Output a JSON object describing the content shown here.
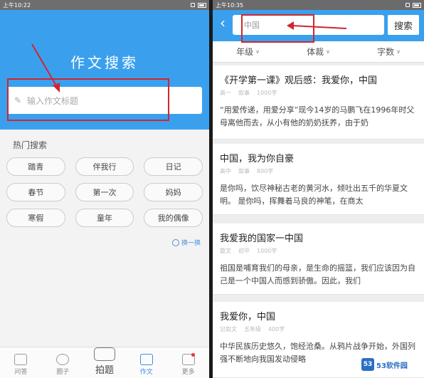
{
  "left": {
    "status_time": "上午10:22",
    "page_title": "作文搜索",
    "search_placeholder": "输入作文标题",
    "hot_title": "热门搜索",
    "tags": [
      "踏青",
      "伴我行",
      "日记",
      "春节",
      "第一次",
      "妈妈",
      "寒假",
      "童年",
      "我的偶像"
    ],
    "refresh_label": "换一换",
    "tabs": [
      {
        "label": "问答",
        "icon": "chat-icon"
      },
      {
        "label": "圈子",
        "icon": "circle-icon"
      },
      {
        "label": "拍题",
        "icon": "camera-icon"
      },
      {
        "label": "作文",
        "icon": "document-icon"
      },
      {
        "label": "更多",
        "icon": "more-icon"
      }
    ]
  },
  "right": {
    "status_time": "上午10:35",
    "search_value": "中国",
    "search_button": "搜索",
    "filters": [
      "年级",
      "体裁",
      "字数"
    ],
    "results": [
      {
        "title": "《开学第一课》观后感：我爱你，中国",
        "meta": [
          "高一",
          "叙事",
          "1000字"
        ],
        "snippet": "“用爱传递，用爱分享”现今14岁的马鹏飞在1996年时父母离他而去，从小有他的奶奶抚养，由于奶"
      },
      {
        "title": "中国，我为你自豪",
        "meta": [
          "高中",
          "叙事",
          "800字"
        ],
        "snippet": "是你吗，饮尽神秘古老的黄河水，倾吐出五千的华夏文明。 是你吗，挥舞着马良的神笔，在商太"
      },
      {
        "title": "我爱我的国家一中国",
        "meta": [
          "散文",
          "初中",
          "1000字"
        ],
        "snippet": "祖国是哺育我们的母亲，是生命的摇篮，我们应该因为自己是一个中国人而感到骄傲。因此，我们"
      },
      {
        "title": "我爱你，中国",
        "meta": [
          "记叙文",
          "五年级",
          "400字"
        ],
        "snippet": "中华民族历史悠久，饱经沧桑。从鸦片战争开始，外国列强不断地向我国发动侵略"
      }
    ]
  },
  "watermark": {
    "logo": "53",
    "text": "53软件园"
  },
  "colors": {
    "header_blue": "#3aa0ee",
    "annotation_red": "#d0262f"
  }
}
